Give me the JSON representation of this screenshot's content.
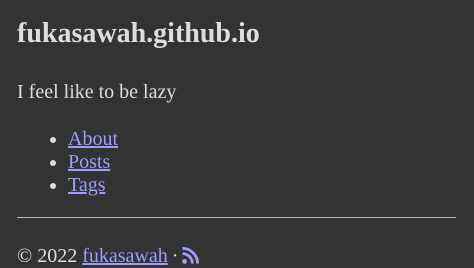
{
  "site": {
    "title": "fukasawah.github.io",
    "tagline": "I feel like to be lazy"
  },
  "nav": {
    "items": [
      {
        "label": "About"
      },
      {
        "label": "Posts"
      },
      {
        "label": "Tags"
      }
    ]
  },
  "footer": {
    "copyright": "© 2022",
    "author_link": "fukasawah",
    "separator": "·",
    "rss_icon": "rss-icon"
  },
  "colors": {
    "background": "#333333",
    "text": "#dddddd",
    "link": "#9d9dff"
  }
}
